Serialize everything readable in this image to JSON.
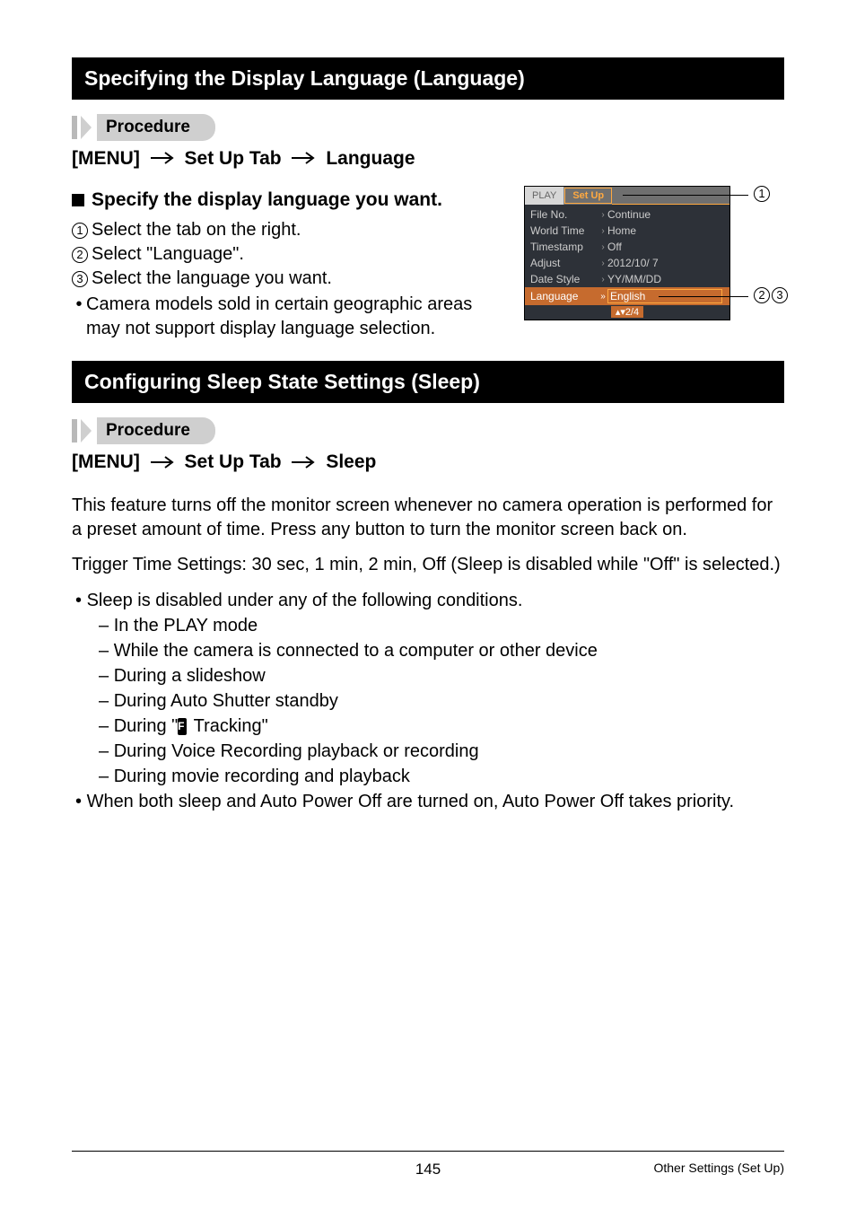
{
  "section1": {
    "title": "Specifying the Display Language (Language)",
    "procedure_label": "Procedure",
    "nav": {
      "step1": "[MENU]",
      "step2": "Set Up Tab",
      "step3": "Language"
    },
    "subhead": "Specify the display language you want.",
    "steps": {
      "s1": "Select the tab on the right.",
      "s2": "Select \"Language\".",
      "s3": "Select the language you want."
    },
    "note_line1": "Camera models sold in certain geographic areas",
    "note_line2": "may not support display language selection."
  },
  "camera": {
    "tab_play": "PLAY",
    "tab_setup": "Set Up",
    "rows": [
      {
        "label": "File No.",
        "value": "Continue"
      },
      {
        "label": "World Time",
        "value": "Home"
      },
      {
        "label": "Timestamp",
        "value": "Off"
      },
      {
        "label": "Adjust",
        "value": "2012/10/ 7"
      },
      {
        "label": "Date Style",
        "value": "YY/MM/DD"
      },
      {
        "label": "Language",
        "value": "English"
      }
    ],
    "footer": "▴▾2/4",
    "callouts": {
      "c1": "1",
      "c2": "2",
      "c3": "3"
    }
  },
  "section2": {
    "title": "Configuring Sleep State Settings (Sleep)",
    "procedure_label": "Procedure",
    "nav": {
      "step1": "[MENU]",
      "step2": "Set Up Tab",
      "step3": "Sleep"
    },
    "body1": "This feature turns off the monitor screen whenever no camera operation is performed for a preset amount of time. Press any button to turn the monitor screen back on.",
    "body2": "Trigger Time Settings: 30 sec, 1 min, 2 min, Off (Sleep is disabled while \"Off\" is selected.)",
    "cond_intro": "Sleep is disabled under any of the following conditions.",
    "conds": {
      "c1": "In the PLAY mode",
      "c2": "While the camera is connected to a computer or other device",
      "c3": "During a slideshow",
      "c4": "During Auto Shutter standby",
      "c5a": "During \"",
      "c5_icon": "•AF",
      "c5b": " Tracking\"",
      "c6": "During Voice Recording playback or recording",
      "c7": "During movie recording and playback"
    },
    "note": "When both sleep and Auto Power Off are turned on, Auto Power Off takes priority."
  },
  "footer": {
    "page": "145",
    "title": "Other Settings (Set Up)"
  }
}
